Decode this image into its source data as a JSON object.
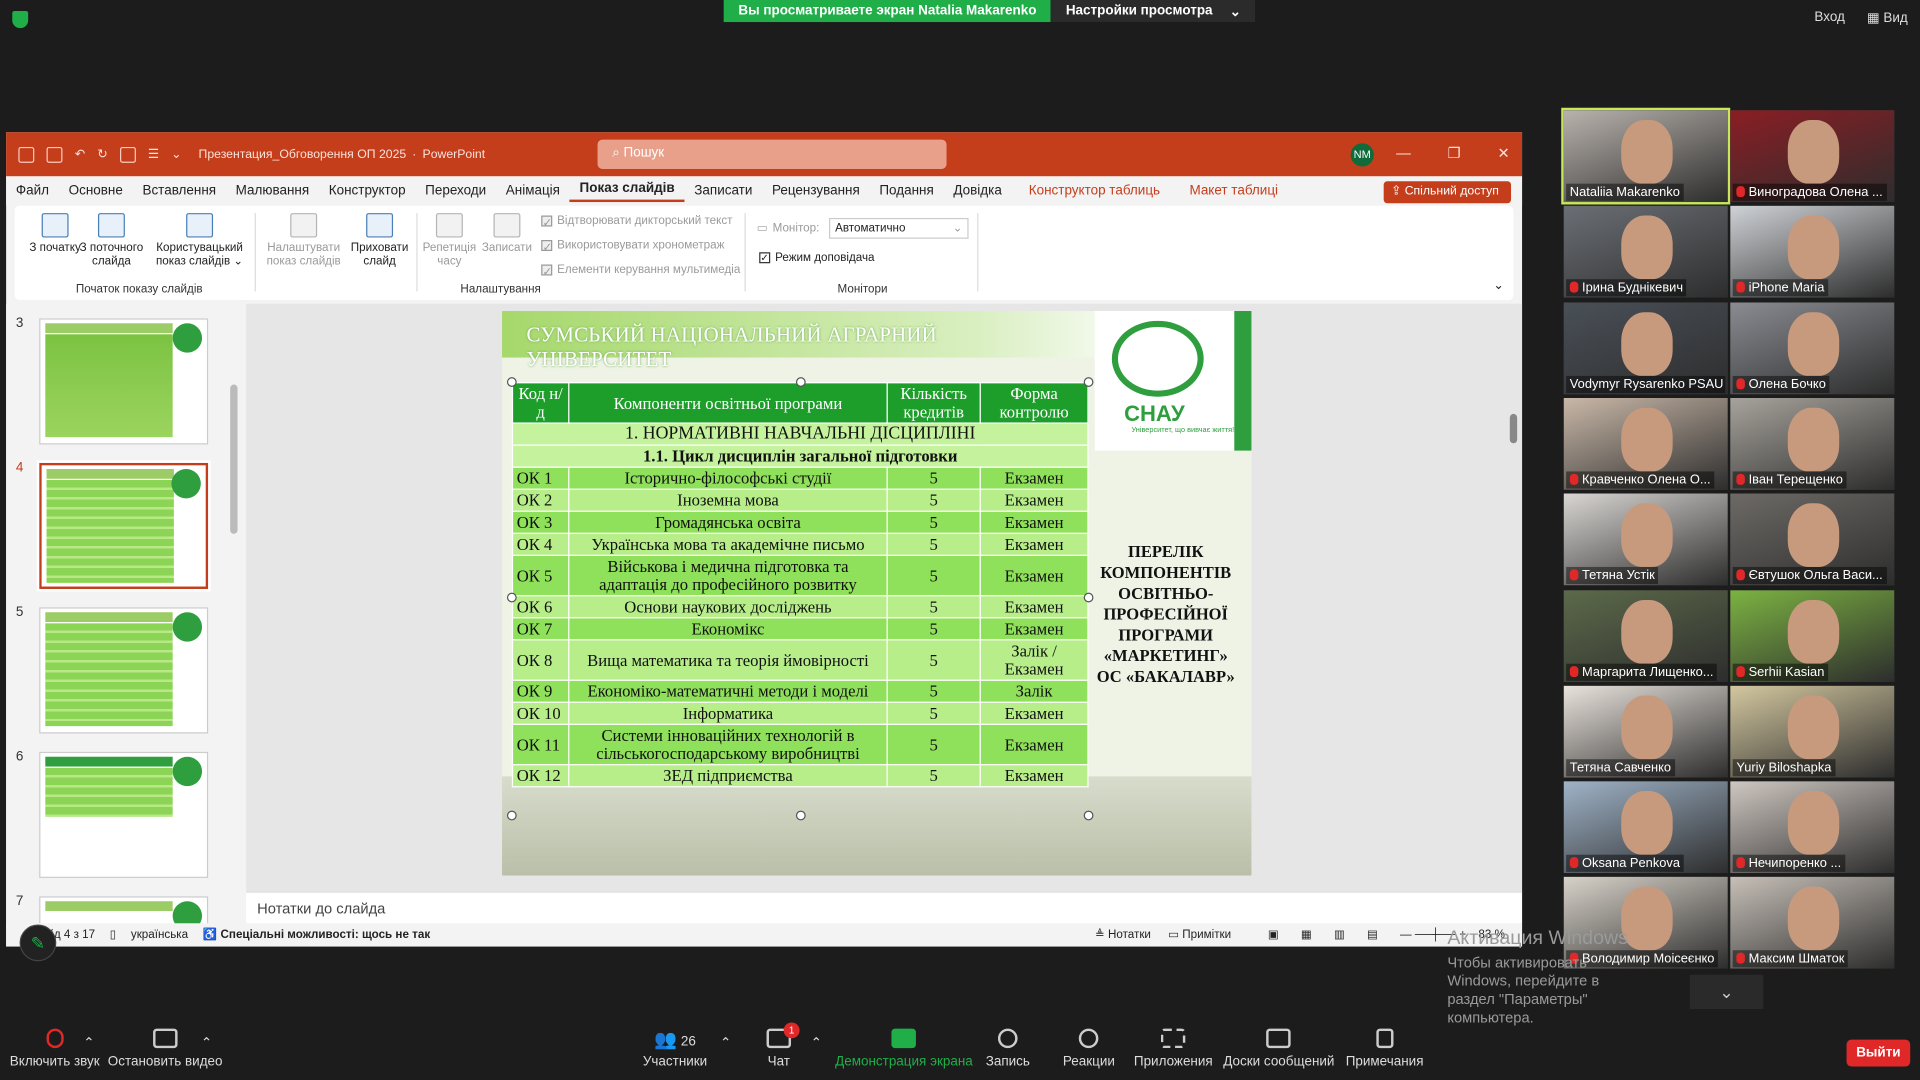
{
  "zoom": {
    "banner_text": "Вы просматриваете экран Natalia Makarenko",
    "view_settings": "Настройки просмотра",
    "top_right": [
      "Вход",
      "Вид"
    ],
    "participants": [
      {
        "name": "Nataliia Makarenko",
        "muted": false,
        "speaking": true
      },
      {
        "name": "Виноградова Олена ...",
        "muted": true
      },
      {
        "name": "Ірина Буднікевич",
        "muted": true
      },
      {
        "name": "iPhone Maria",
        "muted": true
      },
      {
        "name": "Vodymyr Rysarenko PSAU",
        "muted": false
      },
      {
        "name": "Олена Бочко",
        "muted": true
      },
      {
        "name": "Кравченко Олена О...",
        "muted": true
      },
      {
        "name": "Іван Терещенко",
        "muted": true
      },
      {
        "name": "Тетяна Устік",
        "muted": true
      },
      {
        "name": "Євтушок Ольга Васи...",
        "muted": true
      },
      {
        "name": "Маргарита Лищенко...",
        "muted": true
      },
      {
        "name": "Serhii Kasian",
        "muted": true
      },
      {
        "name": "Тетяна Савченко",
        "muted": false
      },
      {
        "name": "Yuriy Biloshapka",
        "muted": false
      },
      {
        "name": "Oksana Penkova",
        "muted": true
      },
      {
        "name": "Нечипоренко ...",
        "muted": true
      },
      {
        "name": "Володимир Моісеєнко",
        "muted": true
      },
      {
        "name": "Максим Шматок",
        "muted": true
      }
    ],
    "toolbar": {
      "mute": "Включить звук",
      "video": "Остановить видео",
      "participants": "Участники",
      "participants_count": "26",
      "chat": "Чат",
      "chat_badge": "1",
      "share": "Демонстрация экрана",
      "record": "Запись",
      "reactions": "Реакции",
      "apps": "Приложения",
      "whiteboards": "Доски сообщений",
      "notes": "Примечания",
      "leave": "Выйти"
    },
    "watermark_title": "Активация Windows",
    "watermark_sub": "Чтобы активировать Windows, перейдите в раздел \"Параметры\" компьютера."
  },
  "ppt": {
    "filename": "Презентация_Обговорення ОП 2025",
    "app": "PowerPoint",
    "search_placeholder": "Пошук",
    "user_initials": "NM",
    "menu": [
      "Файл",
      "Основне",
      "Вставлення",
      "Малювання",
      "Конструктор",
      "Переходи",
      "Анімація",
      "Показ слайдів",
      "Записати",
      "Рецензування",
      "Подання",
      "Довідка"
    ],
    "menu_context": [
      "Конструктор таблиць",
      "Макет таблиці"
    ],
    "share_label": "Спільний доступ",
    "ribbon": {
      "from_start": "З початку",
      "from_current": "З поточного слайда",
      "custom": "Користувацький показ слайдів",
      "group1": "Початок показу слайдів",
      "setup": "Налаштувати показ слайдів",
      "hide": "Приховати слайд",
      "rehearse": "Репетиція часу",
      "record": "Записати",
      "chk_narration": "Відтворювати дикторський текст",
      "chk_timings": "Використовувати хронометраж",
      "chk_media": "Елементи керування мультимедіа",
      "group2": "Налаштування",
      "monitor_label": "Монітор:",
      "monitor_value": "Автоматично",
      "presenter_view": "Режим доповідача",
      "group3": "Монітори"
    },
    "thumb_numbers": [
      "3",
      "4",
      "5",
      "6",
      "7"
    ],
    "notes_placeholder": "Нотатки до слайда",
    "status": {
      "slide": "Слайд 4 з 17",
      "language": "українська",
      "accessibility": "Спеціальні можливості: щось не так",
      "notes": "Нотатки",
      "comments": "Примітки",
      "zoom": "83 %"
    }
  },
  "slide": {
    "header": "СУМСЬКИЙ НАЦІОНАЛЬНИЙ АГРАРНИЙ УНІВЕРСИТЕТ",
    "logo_text": "СНАУ",
    "logo_sub": "Університет, що вивчає життя!",
    "side_title": "ПЕРЕЛІК КОМПОНЕНТІВ ОСВІТНЬО-ПРОФЕСІЙНОЇ ПРОГРАМИ «МАРКЕТИНГ» ОС «БАКАЛАВР»",
    "table": {
      "headers": [
        "Код н/д",
        "Компоненти освітньої програми",
        "Кількість кредитів",
        "Форма контролю"
      ],
      "section1": "1. НОРМАТИВНІ НАВЧАЛЬНІ ДІСЦИПЛІНІ",
      "section2": "1.1. Цикл дисциплін загальної  підготовки",
      "rows": [
        [
          "ОК 1",
          "Історично-філософські студії",
          "5",
          "Екзамен"
        ],
        [
          "ОК 2",
          "Іноземна мова",
          "5",
          "Екзамен"
        ],
        [
          "ОК 3",
          "Громадянська освіта",
          "5",
          "Екзамен"
        ],
        [
          "ОК 4",
          "Українська мова та академічне письмо",
          "5",
          "Екзамен"
        ],
        [
          "ОК 5",
          "Військова і медична підготовка та адаптація до професійного розвитку",
          "5",
          "Екзамен"
        ],
        [
          "ОК 6",
          "Основи наукових досліджень",
          "5",
          "Екзамен"
        ],
        [
          "ОК 7",
          "Економікс",
          "5",
          "Екзамен"
        ],
        [
          "ОК 8",
          "Вища математика та теорія ймовірності",
          "5",
          "Залік / Екзамен"
        ],
        [
          "ОК 9",
          "Економіко-математичні методи і моделі",
          "5",
          "Залік"
        ],
        [
          "ОК 10",
          "Інформатика",
          "5",
          "Екзамен"
        ],
        [
          "ОК 11",
          "Системи інноваційних технологій в сільськогосподарському виробництві",
          "5",
          "Екзамен"
        ],
        [
          "ОК 12",
          "ЗЕД підприємства",
          "5",
          "Екзамен"
        ]
      ]
    }
  }
}
